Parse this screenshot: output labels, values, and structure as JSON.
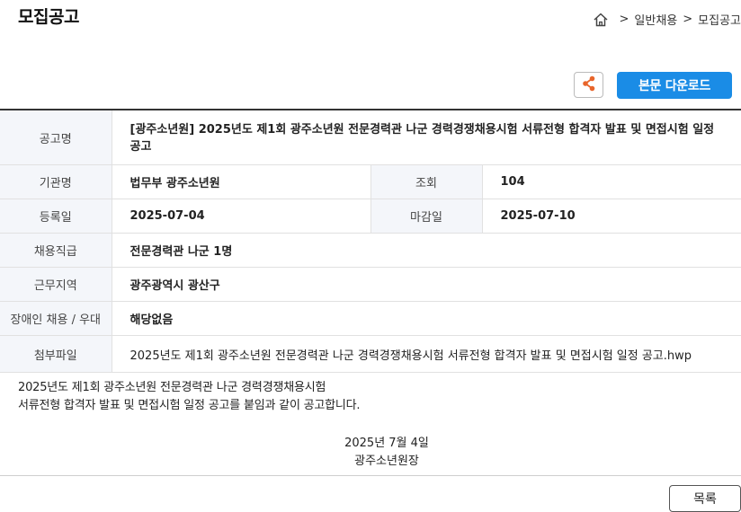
{
  "header": {
    "title": "모집공고",
    "breadcrumb": {
      "home_icon": "home-icon",
      "separator": ">",
      "items": [
        "일반채용",
        "모집공고"
      ]
    }
  },
  "toolbar": {
    "share_icon": "share-icon",
    "download_label": "본문 다운로드"
  },
  "info": {
    "title_label": "공고명",
    "title_value": "[광주소년원] 2025년도 제1회 광주소년원 전문경력관 나군 경력경쟁채용시험 서류전형 합격자 발표 및 면접시험 일정 공고",
    "agency_label": "기관명",
    "agency_value": "법무부 광주소년원",
    "views_label": "조회",
    "views_value": "104",
    "reg_label": "등록일",
    "reg_value": "2025-07-04",
    "deadline_label": "마감일",
    "deadline_value": "2025-07-10",
    "rank_label": "채용직급",
    "rank_value": "전문경력관 나군 1명",
    "region_label": "근무지역",
    "region_value": "광주광역시 광산구",
    "disability_label": "장애인 채용 / 우대",
    "disability_value": "해당없음",
    "attachment_label": "첨부파일",
    "attachment_value": "2025년도 제1회 광주소년원 전문경력관 나군 경력경쟁채용시험 서류전형 합격자 발표 및 면접시험 일정 공고.hwp"
  },
  "content": {
    "line1": "2025년도 제1회 광주소년원 전문경력관 나군 경력경쟁채용시험",
    "line2": "서류전형 합격자 발표 및 면접시험 일정 공고를 붙임과 같이 공고합니다.",
    "date": "2025년 7월 4일",
    "signature": "광주소년원장"
  },
  "footer": {
    "list_label": "목록"
  },
  "colors": {
    "accent": "#1a8ce6",
    "share_icon": "#e8652b",
    "header_cell_bg": "#f4f6fa"
  }
}
